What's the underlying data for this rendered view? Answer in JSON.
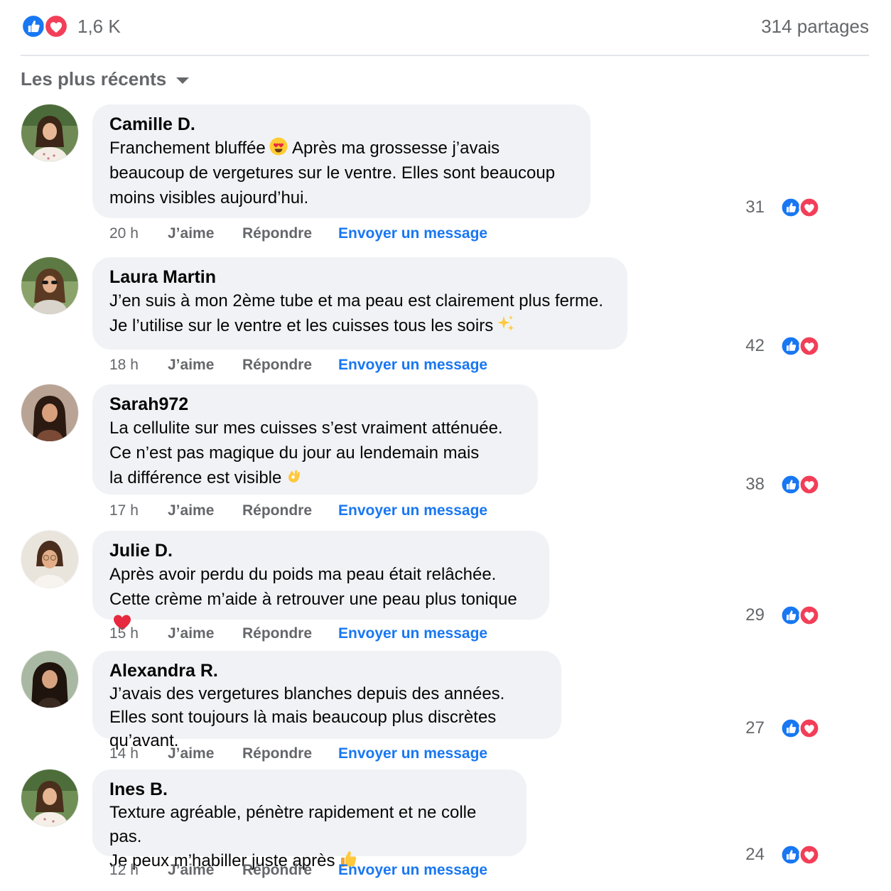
{
  "header": {
    "reactions_count": "1,6 K",
    "shares": "314 partages",
    "sort_label": "Les plus récents"
  },
  "actions": {
    "like": "J’aime",
    "reply": "Répondre",
    "message": "Envoyer un message"
  },
  "colors": {
    "like_blue": "#1877f2",
    "love_red": "#f33e58",
    "bubble_bg": "#f0f2f5",
    "muted": "#65676b"
  },
  "comments": [
    {
      "author": "Camille D.",
      "text_a": "Franchement bluffée",
      "emoji_a": "heart-eyes-emoji",
      "text_b": " Après ma grossesse j’avais\nbeaucoup de vergetures sur le ventre. Elles sont beaucoup\nmoins visibles aujourd’hui.",
      "time": "20 h",
      "reactions": "31"
    },
    {
      "author": "Laura Martin",
      "text_a": "J’en suis à mon 2ème tube et ma peau est clairement plus ferme.\nJe l’utilise sur le ventre et les cuisses tous les soirs",
      "emoji_a": "sparkles-emoji",
      "text_b": "",
      "time": "18 h",
      "reactions": "42"
    },
    {
      "author": "Sarah972",
      "text_a": "La cellulite sur mes cuisses s’est vraiment atténuée.\nCe n’est pas magique du jour au lendemain mais\nla différence est visible",
      "emoji_a": "ok-hand-emoji",
      "text_b": "",
      "time": "17 h",
      "reactions": "38"
    },
    {
      "author": "Julie D.",
      "text_a": "Après avoir perdu du poids ma peau était relâchée.\nCette crème m’aide à retrouver une peau plus tonique",
      "emoji_a": "red-heart-emoji",
      "text_b": "",
      "time": "15 h",
      "reactions": "29"
    },
    {
      "author": "Alexandra R.",
      "text_a": "J’avais des vergetures blanches depuis des années.\nElles sont toujours là mais beaucoup plus discrètes qu’avant.",
      "emoji_a": "",
      "text_b": "",
      "time": "14 h",
      "reactions": "27"
    },
    {
      "author": "Ines B.",
      "text_a": "Texture agréable, pénètre rapidement et ne colle pas.\nJe peux m’habiller juste après",
      "emoji_a": "thumbs-up-emoji",
      "text_b": "",
      "time": "12 h",
      "reactions": "24"
    }
  ]
}
